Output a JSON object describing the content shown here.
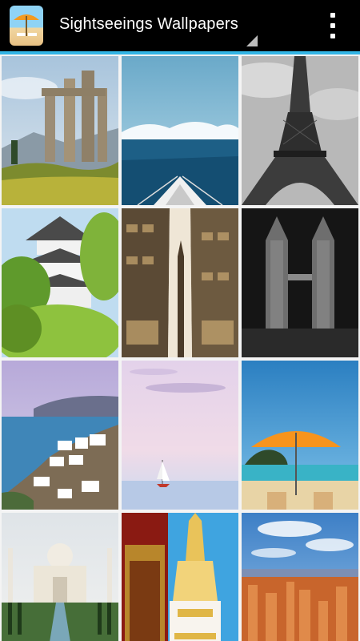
{
  "app": {
    "title": "Sightseeings Wallpapers",
    "icon": "beach-umbrella-icon",
    "accent_color": "#33b5e5",
    "action_bar_color": "#000000"
  },
  "grid": {
    "items": [
      {
        "subject": "ancient-greek-temple-ruins"
      },
      {
        "subject": "sea-view-from-boat-bow"
      },
      {
        "subject": "eiffel-tower"
      },
      {
        "subject": "japanese-castle"
      },
      {
        "subject": "city-street-skyscrapers"
      },
      {
        "subject": "petronas-towers-night"
      },
      {
        "subject": "santorini-coast"
      },
      {
        "subject": "sailboat-pastel-sea"
      },
      {
        "subject": "beach-orange-umbrella"
      },
      {
        "subject": "taj-mahal"
      },
      {
        "subject": "thai-temple-stupa"
      },
      {
        "subject": "bryce-canyon"
      }
    ]
  }
}
